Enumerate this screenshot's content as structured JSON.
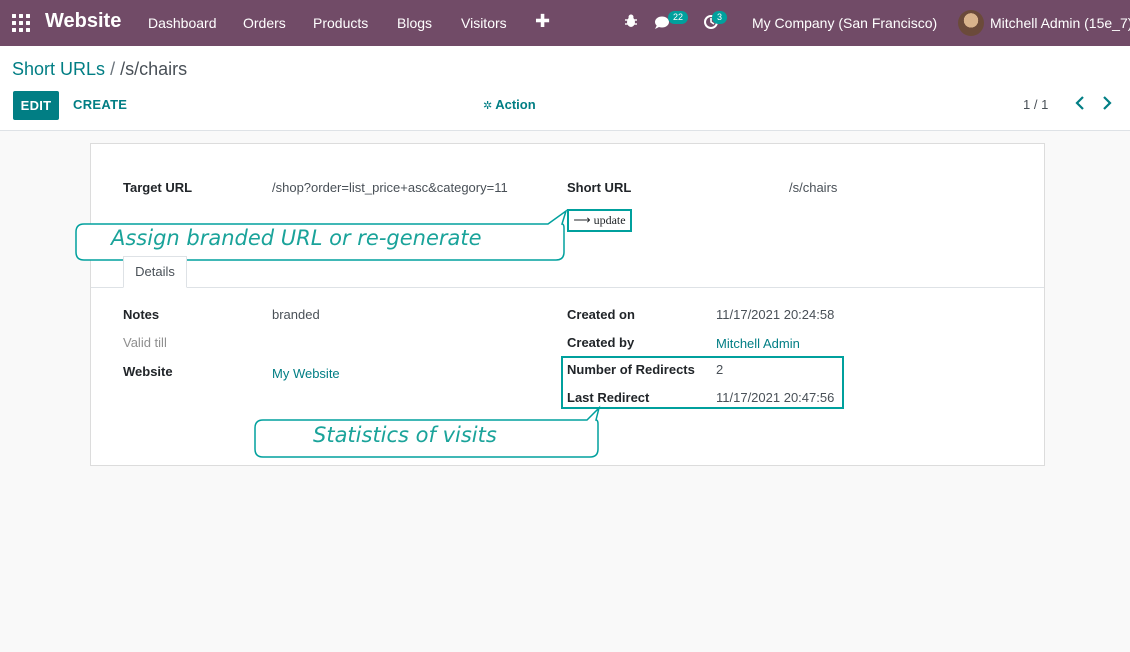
{
  "navbar": {
    "brand": "Website",
    "items": [
      "Dashboard",
      "Orders",
      "Products",
      "Blogs",
      "Visitors"
    ],
    "plus": "✚",
    "messages_badge": "22",
    "activities_badge": "3",
    "company": "My Company (San Francisco)",
    "user": "Mitchell Admin (15e_7)"
  },
  "breadcrumb": {
    "parent": "Short URLs",
    "separator": "/",
    "current": "/s/chairs"
  },
  "toolbar": {
    "edit_label": "EDIT",
    "create_label": "CREATE",
    "action_label": "Action",
    "pager": "1 / 1"
  },
  "form": {
    "target_url_label": "Target URL",
    "target_url_value": "/shop?order=list_price+asc&category=11",
    "short_url_label": "Short URL",
    "short_url_value": "/s/chairs",
    "update_label": "update",
    "tab_details": "Details",
    "notes_label": "Notes",
    "notes_value": "branded",
    "valid_till_label": "Valid till",
    "website_label": "Website",
    "website_value": "My Website",
    "created_on_label": "Created on",
    "created_on_value": "11/17/2021 20:24:58",
    "created_by_label": "Created by",
    "created_by_value": "Mitchell Admin",
    "redirects_label": "Number of Redirects",
    "redirects_value": "2",
    "last_redirect_label": "Last Redirect",
    "last_redirect_value": "11/17/2021 20:47:56"
  },
  "callouts": {
    "branded": "Assign branded URL or re-generate",
    "stats": "Statistics of visits"
  },
  "colors": {
    "navbar": "#714b67",
    "accent": "#017e84",
    "callout": "#00a09d"
  }
}
